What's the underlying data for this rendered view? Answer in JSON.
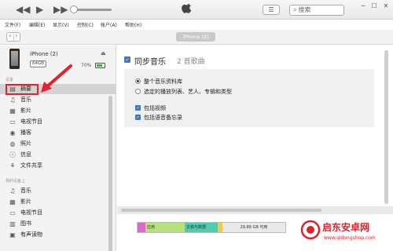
{
  "toolbar": {
    "search_placeholder": "搜索",
    "icons": [
      "rewind-icon",
      "play-icon",
      "fast-forward-icon",
      "apple-logo-icon",
      "list-view-icon",
      "search-icon"
    ]
  },
  "menu": [
    "文件(F)",
    "编辑(E)",
    "显示(V)",
    "控制(C)",
    "帐户(A)",
    "帮助(H)"
  ],
  "nav": {
    "device_tab": "iPhone (2)"
  },
  "device": {
    "name": "iPhone (2)",
    "capacity": "64GB",
    "battery": "70%",
    "battery_level": 0.7
  },
  "sidebar": {
    "settings_items": [
      {
        "label": "摘要",
        "icon": "summary-icon"
      },
      {
        "label": "音乐",
        "icon": "music-icon"
      },
      {
        "label": "影片",
        "icon": "movie-icon"
      },
      {
        "label": "电视节目",
        "icon": "tv-icon"
      },
      {
        "label": "播客",
        "icon": "podcast-icon"
      },
      {
        "label": "照片",
        "icon": "photo-icon"
      },
      {
        "label": "信息",
        "icon": "info-icon"
      },
      {
        "label": "文件共享",
        "icon": "file-sharing-icon"
      }
    ],
    "device_items": [
      {
        "label": "音乐",
        "icon": "music-icon"
      },
      {
        "label": "影片",
        "icon": "movie-icon"
      },
      {
        "label": "电视节目",
        "icon": "tv-icon"
      },
      {
        "label": "图书",
        "icon": "book-icon"
      },
      {
        "label": "有声读物",
        "icon": "audiobook-icon"
      }
    ]
  },
  "main": {
    "sync_title": "同步音乐",
    "sync_count": "2 首歌曲",
    "options": {
      "entire_library": "整个音乐资料库",
      "selected": "选定的播放列表、艺人、专辑和类型",
      "include_videos": "包括视频",
      "include_voice_memos": "包括语音备忘录"
    }
  },
  "storage": {
    "apps": "应用",
    "docs": "文稿与数据",
    "free": "29.88 GB 可用"
  },
  "watermark": {
    "title": "启东安卓网",
    "url": "www.qidongshop.com"
  },
  "colors": {
    "highlight": "#e0232e",
    "check": "#4a74b8",
    "apps_segment": "#b8e07c",
    "docs_segment": "#4ecdb0"
  }
}
